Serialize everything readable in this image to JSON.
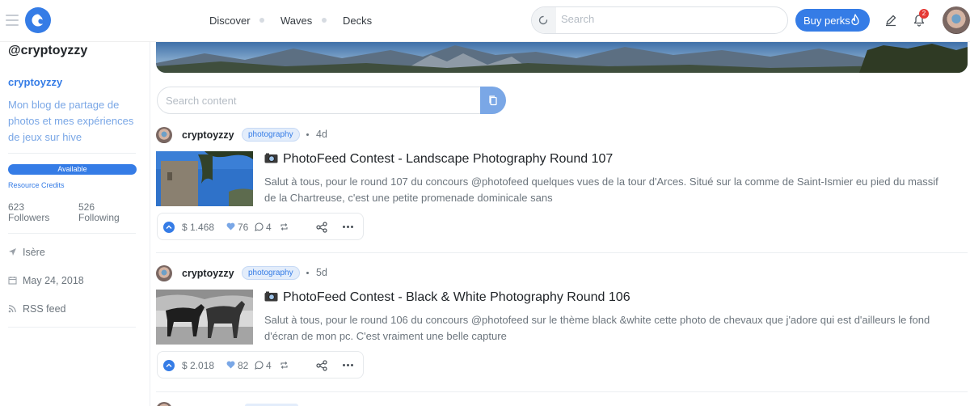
{
  "header": {
    "nav": [
      {
        "label": "Discover"
      },
      {
        "label": "Waves"
      },
      {
        "label": "Decks"
      }
    ],
    "search_placeholder": "Search",
    "buy_label": "Buy perks",
    "notification_count": "2"
  },
  "sidebar": {
    "handle": "@cryptoyzzy",
    "name": "cryptoyzzy",
    "about": "Mon blog de partage de photos et mes expériences de jeux sur hive",
    "rc_status": "Available",
    "rc_label": "Resource Credits",
    "followers_count": "623",
    "followers_label": "Followers",
    "following_count": "526",
    "following_label": "Following",
    "location": "Isère",
    "joined": "May 24, 2018",
    "rss": "RSS feed"
  },
  "content": {
    "search_placeholder": "Search content"
  },
  "posts": [
    {
      "author": "cryptoyzzy",
      "tag": "photography",
      "age": "4d",
      "title": "PhotoFeed Contest - Landscape Photography Round 107",
      "summary": "Salut à tous, pour le round 107 du concours @photofeed quelques vues de la tour d'Arces. Situé sur la comme de Saint-Ismier eu pied du massif de la Chartreuse, c'est une petite promenade dominicale sans",
      "payout": "$ 1.468",
      "votes": "76",
      "comments": "4"
    },
    {
      "author": "cryptoyzzy",
      "tag": "photography",
      "age": "5d",
      "title": "PhotoFeed Contest - Black & White Photography Round 106",
      "summary": "Salut à tous, pour le round 106 du concours @photofeed sur le thème black &white cette photo de chevaux que j'adore qui est d'ailleurs le fond d'écran de mon pc. C'est vraiment une belle capture",
      "payout": "$ 2.018",
      "votes": "82",
      "comments": "4"
    }
  ],
  "colors": {
    "accent": "#357ce6",
    "accent_light": "#7aa7e6",
    "muted": "#6c757d"
  }
}
